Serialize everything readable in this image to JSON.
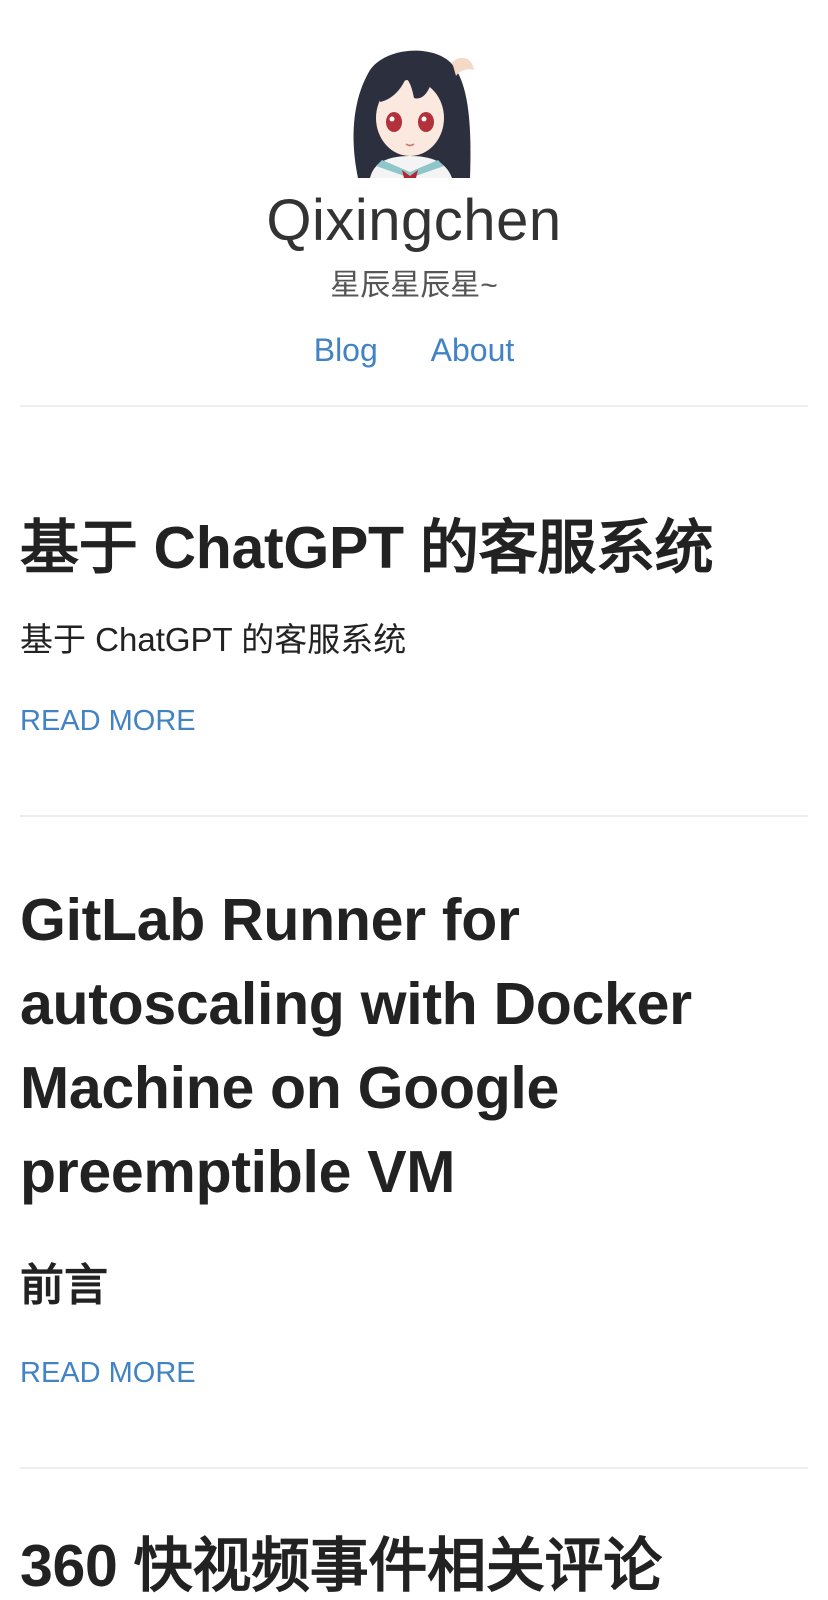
{
  "site": {
    "title": "Qixingchen",
    "subtitle": "星辰星辰星~"
  },
  "nav": {
    "items": [
      {
        "label": "Blog"
      },
      {
        "label": "About"
      }
    ]
  },
  "posts": [
    {
      "title": "基于 ChatGPT 的客服系统",
      "excerpt": "基于 ChatGPT 的客服系统",
      "read_more": "READ MORE"
    },
    {
      "title": "GitLab Runner for autoscaling with Docker Machine on Google preemptible VM",
      "excerpt": "前言",
      "read_more": "READ MORE"
    },
    {
      "title": "360 快视频事件相关评论"
    }
  ],
  "colors": {
    "link": "#4183c4",
    "text": "#222222",
    "divider": "#eeeeee"
  }
}
